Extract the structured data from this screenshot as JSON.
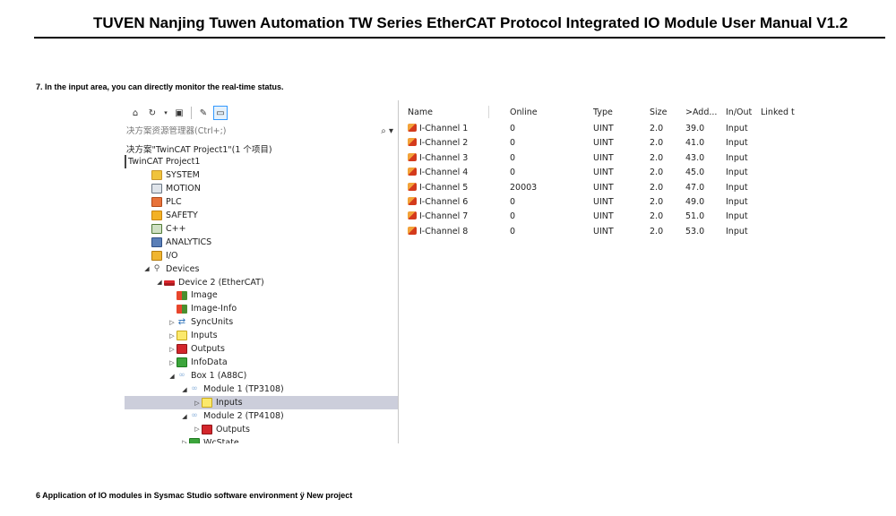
{
  "document": {
    "header_title": "TUVEN Nanjing Tuwen Automation TW Series EtherCAT Protocol Integrated IO Module User Manual V1.2",
    "step_text": "7. In the input area, you can directly monitor the real-time status.",
    "footer_text": "6 Application of IO modules in Sysmac Studio software environment ÿ New project"
  },
  "explorer": {
    "search_placeholder": "决方案资源管理器(Ctrl+;)",
    "search_icon": "search-icon",
    "toolbar_icons": [
      "home-icon",
      "sync-icon",
      "dropdown-icon",
      "collapse-icon",
      "properties-icon",
      "preview-icon"
    ],
    "tree": [
      {
        "label": "决方案\"TwinCAT Project1\"(1 个项目)",
        "level": 0,
        "arrow": "",
        "icon": ""
      },
      {
        "label": "TwinCAT Project1",
        "level": 0,
        "arrow": "",
        "icon": ""
      },
      {
        "label": "SYSTEM",
        "level": 1,
        "arrow": "",
        "icon": "folder-yellow"
      },
      {
        "label": "MOTION",
        "level": 1,
        "arrow": "",
        "icon": "motion"
      },
      {
        "label": "PLC",
        "level": 1,
        "arrow": "",
        "icon": "plc"
      },
      {
        "label": "SAFETY",
        "level": 1,
        "arrow": "",
        "icon": "safety"
      },
      {
        "label": "C++",
        "level": 1,
        "arrow": "",
        "icon": "cpp"
      },
      {
        "label": "ANALYTICS",
        "level": 1,
        "arrow": "",
        "icon": "analytics"
      },
      {
        "label": "I/O",
        "level": 1,
        "arrow": "",
        "icon": "io"
      },
      {
        "label": "Devices",
        "level": 1,
        "arrow": "◢",
        "icon": "devices"
      },
      {
        "label": "Device 2 (EtherCAT)",
        "level": 2,
        "arrow": "◢",
        "icon": "ecat"
      },
      {
        "label": "Image",
        "level": 3,
        "arrow": "",
        "icon": "image"
      },
      {
        "label": "Image-Info",
        "level": 3,
        "arrow": "",
        "icon": "image"
      },
      {
        "label": "SyncUnits",
        "level": 3,
        "arrow": "▷",
        "icon": "sync"
      },
      {
        "label": "Inputs",
        "level": 3,
        "arrow": "▷",
        "icon": "inputs"
      },
      {
        "label": "Outputs",
        "level": 3,
        "arrow": "▷",
        "icon": "outputs"
      },
      {
        "label": "InfoData",
        "level": 3,
        "arrow": "▷",
        "icon": "infodata"
      },
      {
        "label": "Box 1 (A88C)",
        "level": 3,
        "arrow": "◢",
        "icon": "box"
      },
      {
        "label": "Module 1 (TP3108)",
        "level": 4,
        "arrow": "◢",
        "icon": "box"
      },
      {
        "label": "Inputs",
        "level": 5,
        "arrow": "▷",
        "icon": "inputs",
        "selected": true
      },
      {
        "label": "Module 2 (TP4108)",
        "level": 4,
        "arrow": "◢",
        "icon": "box"
      },
      {
        "label": "Outputs",
        "level": 5,
        "arrow": "▷",
        "icon": "outputs"
      },
      {
        "label": "WcState",
        "level": 4,
        "arrow": "▷",
        "icon": "infodata"
      }
    ]
  },
  "grid": {
    "headers": [
      "Name",
      "Online",
      "Type",
      "Size",
      ">Add...",
      "In/Out",
      "Linked t"
    ],
    "rows": [
      [
        "I-Channel 1",
        "0",
        "UINT",
        "2.0",
        "39.0",
        "Input"
      ],
      [
        "I-Channel 2",
        "0",
        "UINT",
        "2.0",
        "41.0",
        "Input"
      ],
      [
        "I-Channel 3",
        "0",
        "UINT",
        "2.0",
        "43.0",
        "Input"
      ],
      [
        "I-Channel 4",
        "0",
        "UINT",
        "2.0",
        "45.0",
        "Input"
      ],
      [
        "I-Channel 5",
        "20003",
        "UINT",
        "2.0",
        "47.0",
        "Input"
      ],
      [
        "I-Channel 6",
        "0",
        "UINT",
        "2.0",
        "49.0",
        "Input"
      ],
      [
        "I-Channel 7",
        "0",
        "UINT",
        "2.0",
        "51.0",
        "Input"
      ],
      [
        "I-Channel 8",
        "0",
        "UINT",
        "2.0",
        "53.0",
        "Input"
      ]
    ]
  }
}
